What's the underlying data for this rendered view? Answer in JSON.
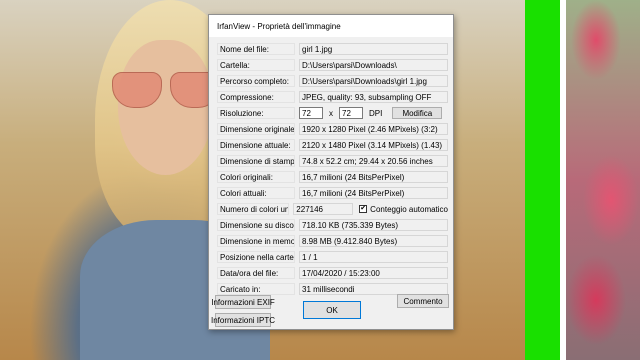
{
  "dialog": {
    "title": "IrfanView - Proprietà dell'immagine",
    "fields": {
      "filename": {
        "label": "Nome del file:",
        "value": "girl 1.jpg"
      },
      "folder": {
        "label": "Cartella:",
        "value": "D:\\Users\\parsi\\Downloads\\"
      },
      "fullpath": {
        "label": "Percorso completo:",
        "value": "D:\\Users\\parsi\\Downloads\\girl 1.jpg"
      },
      "compression": {
        "label": "Compressione:",
        "value": "JPEG, quality: 93, subsampling OFF"
      },
      "resolution": {
        "label": "Risoluzione:",
        "x": "72",
        "sep": "x",
        "y": "72",
        "unit": "DPI",
        "modify_label": "Modifica"
      },
      "original_size": {
        "label": "Dimensione originale:",
        "value": "1920 x 1280  Pixel (2.46 MPixels) (3:2)"
      },
      "current_size": {
        "label": "Dimensione attuale:",
        "value": "2120 x 1480  Pixel (3.14 MPixels) (1.43)"
      },
      "print_size": {
        "label": "Dimensione di stampa",
        "value": "74.8 x 52.2 cm; 29.44 x 20.56 inches"
      },
      "original_colors": {
        "label": "Colori originali:",
        "value": "16,7 milioni   (24 BitsPerPixel)"
      },
      "current_colors": {
        "label": "Colori attuali:",
        "value": "16,7 milioni   (24 BitsPerPixel)"
      },
      "unique_colors": {
        "label": "Numero di colori unici:",
        "value": "227146",
        "auto_label": "Conteggio automatico",
        "auto_checked": true
      },
      "disk_size": {
        "label": "Dimensione su disco:",
        "value": "718.10 KB (735.339 Bytes)"
      },
      "memory_size": {
        "label": "Dimensione in memoria:",
        "value": "8.98  MB (9.412.840 Bytes)"
      },
      "folder_position": {
        "label": "Posizione nella cartella:",
        "value": "1  /  1"
      },
      "file_date": {
        "label": "Data/ora del file:",
        "value": "17/04/2020 / 15:23:00"
      },
      "loaded_in": {
        "label": "Caricato in:",
        "value": "31 millisecondi"
      }
    },
    "buttons": {
      "exif": "Informazioni EXIF",
      "iptc": "Informazioni IPTC",
      "comment": "Commento",
      "ok": "OK"
    },
    "checkmark": "✔"
  }
}
